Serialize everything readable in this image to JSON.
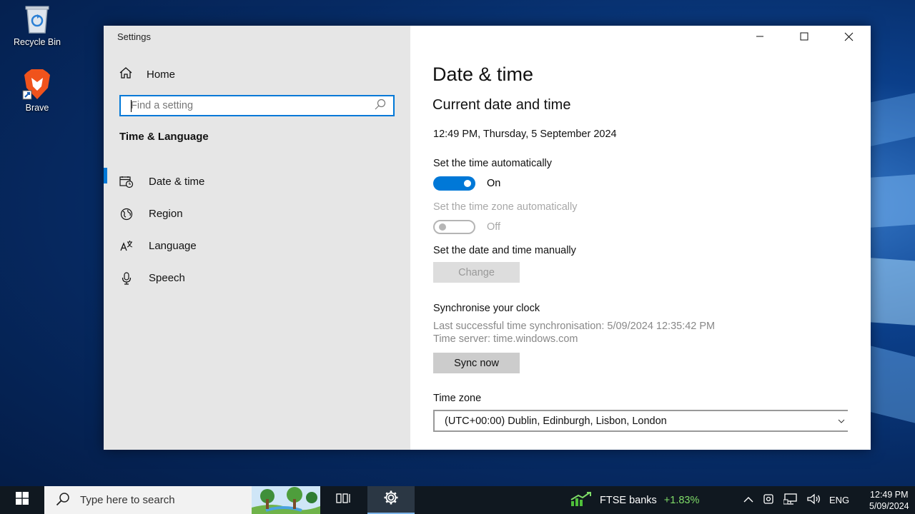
{
  "desktop": {
    "icons": [
      {
        "label": "Recycle Bin",
        "icon": "recycle-bin-icon"
      },
      {
        "label": "Brave",
        "icon": "brave-icon"
      }
    ]
  },
  "window": {
    "title": "Settings",
    "controls": [
      "minimize-icon",
      "maximize-icon",
      "close-icon"
    ]
  },
  "sidebar": {
    "home_label": "Home",
    "search_placeholder": "Find a setting",
    "section_title": "Time & Language",
    "items": [
      {
        "label": "Date & time",
        "icon": "calendar-clock-icon",
        "active": true
      },
      {
        "label": "Region",
        "icon": "globe-icon",
        "active": false
      },
      {
        "label": "Language",
        "icon": "language-icon",
        "active": false
      },
      {
        "label": "Speech",
        "icon": "microphone-icon",
        "active": false
      }
    ]
  },
  "main": {
    "page_title": "Date & time",
    "section_title": "Current date and time",
    "current_datetime": "12:49 PM, Thursday, 5 September 2024",
    "auto_time": {
      "label": "Set the time automatically",
      "state": "On",
      "value": true
    },
    "auto_zone": {
      "label": "Set the time zone automatically",
      "state": "Off",
      "value": false
    },
    "manual": {
      "label": "Set the date and time manually",
      "button": "Change"
    },
    "sync": {
      "title": "Synchronise your clock",
      "last_sync": "Last successful time synchronisation: 5/09/2024 12:35:42 PM",
      "server": "Time server: time.windows.com",
      "button": "Sync now"
    },
    "timezone": {
      "label": "Time zone",
      "value": "(UTC+00:00) Dublin, Edinburgh, Lisbon, London"
    }
  },
  "taskbar": {
    "search_placeholder": "Type here to search",
    "stock_name": "FTSE banks",
    "stock_change": "+1.83%",
    "language": "ENG",
    "time": "12:49 PM",
    "date": "5/09/2024",
    "colors": {
      "accent": "#0078d7",
      "stock_up": "#7fdc68"
    }
  }
}
